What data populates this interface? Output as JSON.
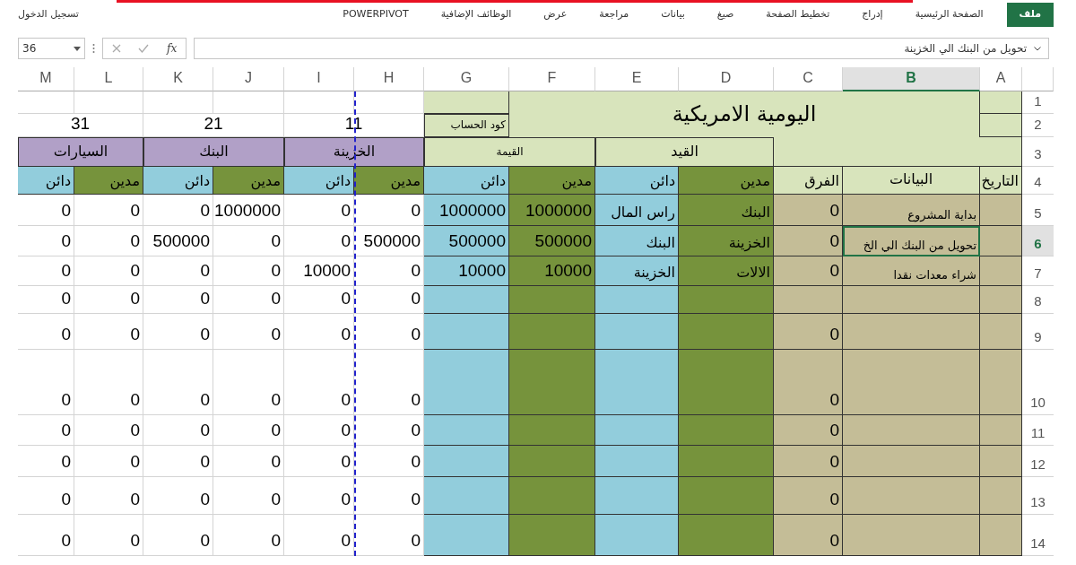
{
  "ribbon": {
    "tabs": [
      {
        "label": "ملف",
        "selected": true
      },
      {
        "label": "الصفحة الرئيسية",
        "selected": false
      },
      {
        "label": "إدراج",
        "selected": false
      },
      {
        "label": "تخطيط الصفحة",
        "selected": false
      },
      {
        "label": "صيغ",
        "selected": false
      },
      {
        "label": "بيانات",
        "selected": false
      },
      {
        "label": "مراجعة",
        "selected": false
      },
      {
        "label": "عرض",
        "selected": false
      },
      {
        "label": "الوظائف الإضافية",
        "selected": false
      },
      {
        "label": "POWERPIVOT",
        "selected": false
      }
    ],
    "sign_in": "تسجيل الدخول"
  },
  "formula_bar": {
    "name_box": "36",
    "function_label": "fx",
    "formula": "تحويل من البنك الي الخزينة"
  },
  "columns": [
    {
      "label": "A",
      "selected": false
    },
    {
      "label": "B",
      "selected": true
    },
    {
      "label": "C",
      "selected": false
    },
    {
      "label": "D",
      "selected": false
    },
    {
      "label": "E",
      "selected": false
    },
    {
      "label": "F",
      "selected": false
    },
    {
      "label": "G",
      "selected": false
    },
    {
      "label": "H",
      "selected": false
    },
    {
      "label": "I",
      "selected": false
    },
    {
      "label": "J",
      "selected": false
    },
    {
      "label": "K",
      "selected": false
    },
    {
      "label": "L",
      "selected": false
    },
    {
      "label": "M",
      "selected": false
    }
  ],
  "row_numbers": [
    {
      "label": "1",
      "selected": false
    },
    {
      "label": "2",
      "selected": false
    },
    {
      "label": "3",
      "selected": false
    },
    {
      "label": "4",
      "selected": false
    },
    {
      "label": "5",
      "selected": false
    },
    {
      "label": "6",
      "selected": true
    },
    {
      "label": "7",
      "selected": false
    },
    {
      "label": "8",
      "selected": false
    },
    {
      "label": "9",
      "selected": false
    },
    {
      "label": "10",
      "selected": false
    },
    {
      "label": "11",
      "selected": false
    },
    {
      "label": "12",
      "selected": false
    },
    {
      "label": "13",
      "selected": false
    },
    {
      "label": "14",
      "selected": false
    }
  ],
  "title": "اليومية الامريكية",
  "account_code_label": "كود الحساب",
  "entry_header": "القيد",
  "value_header": "القيمة",
  "accounts": [
    {
      "code": "11",
      "name": "الخزينة"
    },
    {
      "code": "21",
      "name": "البنك"
    },
    {
      "code": "31",
      "name": "السيارات"
    }
  ],
  "date_header": "التاريخ",
  "description_header": "البيانات",
  "diff_header": "الفرق",
  "entry_subheaders": [
    "مدين",
    "دائن"
  ],
  "value_subheaders": [
    "مدين",
    "دائن"
  ],
  "ledger_subheaders": [
    "مدين",
    "دائن",
    "مدين",
    "دائن",
    "مدين",
    "دائن"
  ],
  "entries": [
    {
      "description": "بداية المشروع",
      "diff": "0",
      "entry_debit": "البنك",
      "entry_credit": "راس المال",
      "value_debit": "1000000",
      "value_credit": "1000000",
      "ledger": [
        "0",
        "0",
        "1000000",
        "0",
        "0",
        "0"
      ],
      "selected": false
    },
    {
      "description": "تحويل من البنك الي الخ",
      "diff": "0",
      "entry_debit": "الخزينة",
      "entry_credit": "البنك",
      "value_debit": "500000",
      "value_credit": "500000",
      "ledger": [
        "500000",
        "0",
        "0",
        "500000",
        "0",
        "0"
      ],
      "selected": true
    },
    {
      "description": "شراء معدات نقدا",
      "diff": "0",
      "entry_debit": "الالات",
      "entry_credit": "الخزينة",
      "value_debit": "10000",
      "value_credit": "10000",
      "ledger": [
        "0",
        "10000",
        "0",
        "0",
        "0",
        "0"
      ],
      "selected": false
    },
    {
      "ledger": [
        "0",
        "0",
        "0",
        "0",
        "0",
        "0"
      ],
      "selected": false
    },
    {
      "diff": "0",
      "ledger": [
        "0",
        "0",
        "0",
        "0",
        "0",
        "0"
      ],
      "selected": false
    },
    {
      "diff": "0",
      "ledger": [
        "0",
        "0",
        "0",
        "0",
        "0",
        "0"
      ],
      "selected": false
    },
    {
      "diff": "0",
      "ledger": [
        "0",
        "0",
        "0",
        "0",
        "0",
        "0"
      ],
      "selected": false
    },
    {
      "diff": "0",
      "ledger": [
        "0",
        "0",
        "0",
        "0",
        "0",
        "0"
      ],
      "selected": false
    },
    {
      "diff": "0",
      "ledger": [
        "0",
        "0",
        "0",
        "0",
        "0",
        "0"
      ],
      "selected": false
    },
    {
      "diff": "0",
      "ledger": [
        "0",
        "0",
        "0",
        "0",
        "0",
        "0"
      ],
      "selected": false
    }
  ]
}
